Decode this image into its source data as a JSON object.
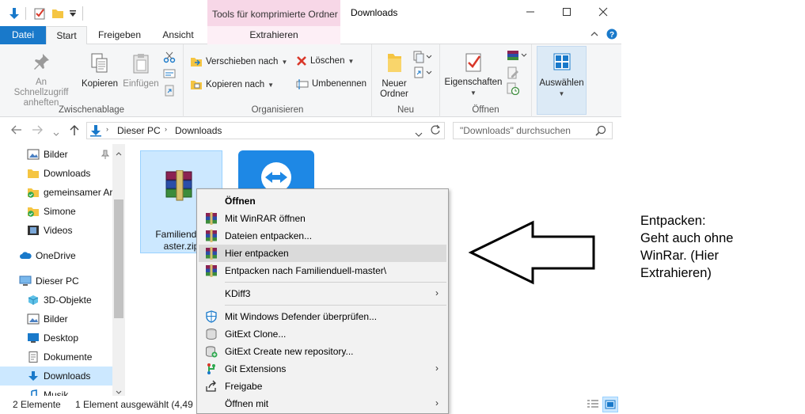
{
  "titlebar": {
    "context_tab": "Tools für komprimierte Ordner",
    "title": "Downloads"
  },
  "tabs": {
    "datei": "Datei",
    "start": "Start",
    "freigeben": "Freigeben",
    "ansicht": "Ansicht",
    "extrahieren": "Extrahieren"
  },
  "ribbon": {
    "clipboard": {
      "label": "Zwischenablage",
      "pin": "An Schnellzugriff anheften",
      "copy": "Kopieren",
      "paste": "Einfügen"
    },
    "organize": {
      "label": "Organisieren",
      "move_to": "Verschieben nach",
      "copy_to": "Kopieren nach",
      "delete": "Löschen",
      "rename": "Umbenennen"
    },
    "new": {
      "label": "Neu",
      "new_folder": "Neuer Ordner"
    },
    "open": {
      "label": "Öffnen",
      "properties": "Eigenschaften"
    },
    "select": {
      "label": "Auswählen"
    }
  },
  "address": {
    "crumbs": [
      "Dieser PC",
      "Downloads"
    ],
    "search_placeholder": "\"Downloads\" durchsuchen"
  },
  "nav": {
    "items": [
      {
        "label": "Bilder"
      },
      {
        "label": "Downloads"
      },
      {
        "label": "gemeinsamer Ar"
      },
      {
        "label": "Simone"
      },
      {
        "label": "Videos"
      },
      {
        "label": "OneDrive"
      },
      {
        "label": "Dieser PC"
      },
      {
        "label": "3D-Objekte"
      },
      {
        "label": "Bilder"
      },
      {
        "label": "Desktop"
      },
      {
        "label": "Dokumente"
      },
      {
        "label": "Downloads"
      },
      {
        "label": "Musik"
      }
    ]
  },
  "files": {
    "file1_line1": "Familiendue",
    "file1_line2": "aster.zip"
  },
  "status": {
    "count": "2 Elemente",
    "selection": "1 Element ausgewählt (4,49 M"
  },
  "menu": {
    "items": [
      {
        "label": "Öffnen"
      },
      {
        "label": "Mit WinRAR öffnen"
      },
      {
        "label": "Dateien entpacken..."
      },
      {
        "label": "Hier entpacken"
      },
      {
        "label": "Entpacken nach Familienduell-master\\"
      },
      {
        "label": "KDiff3"
      },
      {
        "label": "Mit Windows Defender überprüfen..."
      },
      {
        "label": "GitExt Clone..."
      },
      {
        "label": "GitExt Create new repository..."
      },
      {
        "label": "Git Extensions"
      },
      {
        "label": "Freigabe"
      },
      {
        "label": "Öffnen mit"
      }
    ]
  },
  "annotation": {
    "lines": [
      "Entpacken:",
      "Geht auch ohne",
      "WinRar. (Hier",
      "Extrahieren)"
    ]
  },
  "colors": {
    "accent": "#1979ca",
    "selection": "#cce8ff",
    "context_tab": "#f7d7e7"
  }
}
